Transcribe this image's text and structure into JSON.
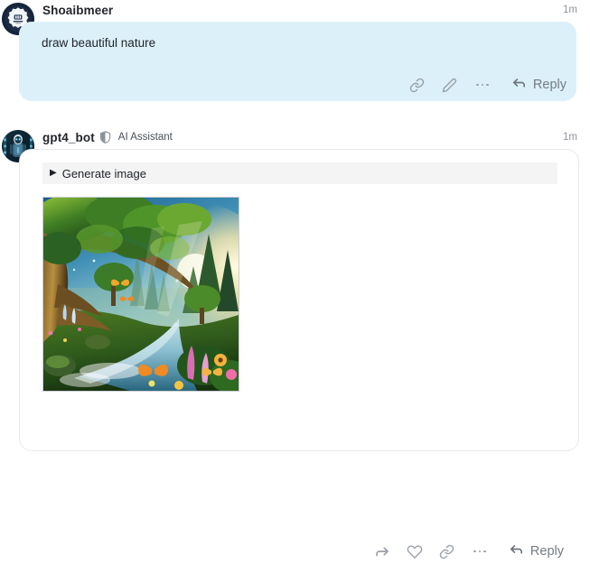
{
  "theme": {
    "user_bubble_bg": "#dcf0fa",
    "bot_bubble_bg": "#ffffff",
    "bot_bubble_border": "#e6e8ea",
    "disclosure_bg": "#f4f4f5",
    "icon_color": "#9aa1a8",
    "reply_text_color": "#747b82",
    "username_color": "#22262b",
    "timestamp_color": "#8e959c",
    "page_bg": "#ffffff"
  },
  "posts": [
    {
      "id": "post-user",
      "avatar_name": "user-avatar-seal-logo",
      "username": "Shoaibmeer",
      "role_badge": "",
      "verified": false,
      "timestamp": "1m",
      "message": "draw beautiful nature",
      "actions": [
        {
          "name": "copy-link-button",
          "icon": "link-icon",
          "label": ""
        },
        {
          "name": "edit-button",
          "icon": "pencil-icon",
          "label": ""
        },
        {
          "name": "more-options-button",
          "icon": "ellipsis-icon",
          "label": ""
        },
        {
          "name": "reply-button",
          "icon": "reply-arrow-icon",
          "label": "Reply"
        }
      ]
    },
    {
      "id": "post-bot",
      "avatar_name": "bot-avatar-robot-portrait",
      "username": "gpt4_bot",
      "role_badge": "AI Assistant",
      "verified": true,
      "timestamp": "1m",
      "disclosure": {
        "name": "generate-image-disclosure",
        "arrow": "▶",
        "label": "Generate image",
        "expanded": false
      },
      "attachment": {
        "name": "generated-image-thumbnail",
        "alt": "AI generated fantasy forest landscape with a large tree, sunlit glade, stream, waterfall, butterflies and wildflowers"
      },
      "actions": [
        {
          "name": "forward-button",
          "icon": "forward-arrow-icon",
          "label": ""
        },
        {
          "name": "like-button",
          "icon": "heart-icon",
          "label": ""
        },
        {
          "name": "copy-link-button",
          "icon": "link-icon",
          "label": ""
        },
        {
          "name": "more-options-button",
          "icon": "ellipsis-icon",
          "label": ""
        },
        {
          "name": "reply-button",
          "icon": "reply-arrow-icon",
          "label": "Reply"
        }
      ]
    }
  ]
}
